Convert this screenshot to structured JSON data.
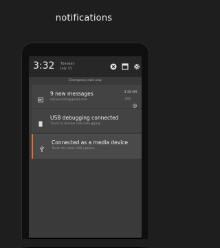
{
  "headline": "notifications",
  "status": {
    "time": "3:32",
    "day": "Tuesday",
    "date": "July 31"
  },
  "emergency_text": "Emergency calls only",
  "notifications": [
    {
      "title": "9 new messages",
      "subtitle": "lolkopodam@gmail.com",
      "time": "3:30 AM",
      "count": "433",
      "icon": "message-icon"
    },
    {
      "title": "USB debugging connected",
      "subtitle": "Touch to disable USB debugging.",
      "icon": "debug-icon"
    },
    {
      "title": "Connected as a media device",
      "subtitle": "Touch for other USB options",
      "icon": "usb-icon"
    }
  ],
  "colors": {
    "accent": "#e96f30",
    "background": "#1e1e1e"
  }
}
